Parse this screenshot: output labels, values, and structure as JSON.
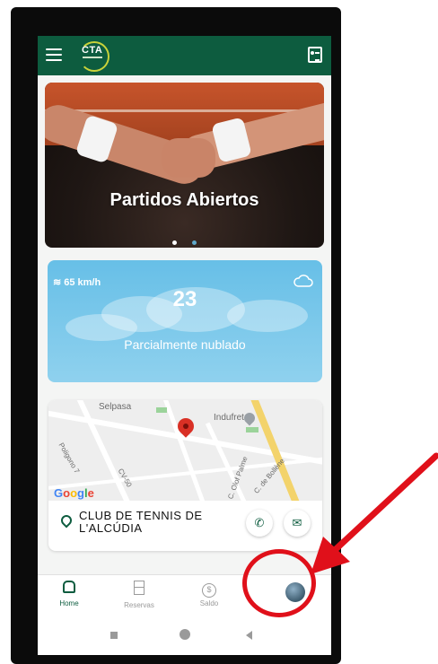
{
  "header": {
    "logo_text": "CTA",
    "menu_icon": "hamburger-menu-icon",
    "contact_icon": "contact-card-icon"
  },
  "banner": {
    "title": "Partidos Abiertos",
    "dots": [
      {
        "active": false,
        "color": "#ffffff"
      },
      {
        "active": true,
        "color": "#5fa8c9"
      }
    ]
  },
  "weather": {
    "wind": "65 km/h",
    "temperature": "23",
    "condition": "Parcialmente nublado",
    "icon": "cloud-icon"
  },
  "map": {
    "labels": {
      "selpasa": "Selpasa",
      "indufret": "Indufret",
      "poligono": "Poligono 7",
      "cv50": "CV-50",
      "olof_palme": "C. Olof Palme",
      "bollene": "C. de Bollène",
      "google": "Google"
    },
    "club_name": "CLUB DE TENNIS DE L'ALCÚDIA",
    "phone_icon": "phone-icon",
    "mail_icon": "mail-icon"
  },
  "bottom_nav": {
    "items": [
      {
        "label": "Home",
        "icon": "home-icon",
        "active": true
      },
      {
        "label": "Reservas",
        "icon": "reservations-icon",
        "active": false
      },
      {
        "label": "Saldo",
        "icon": "balance-icon",
        "active": false
      },
      {
        "label": "",
        "icon": "profile-avatar-icon",
        "active": false
      }
    ]
  },
  "colors": {
    "brand_green": "#0d5c3f",
    "weather_blue": "#67bfe7",
    "annotation_red": "#e0101a"
  }
}
